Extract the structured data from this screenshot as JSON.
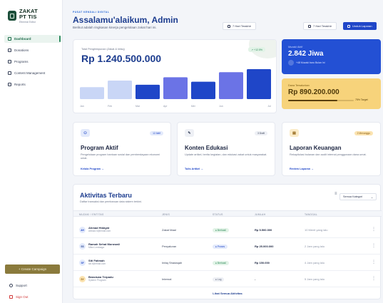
{
  "brand": {
    "title_line1": "ZAKAT",
    "title_line2": "PT TIS",
    "subtitle": "Ethereal Editor"
  },
  "sidebar": {
    "items": [
      {
        "label": "Dashboard",
        "icon": "grid-icon",
        "active": true
      },
      {
        "label": "Donations",
        "icon": "hand-heart-icon",
        "active": false
      },
      {
        "label": "Programs",
        "icon": "layers-icon",
        "active": false
      },
      {
        "label": "Content Management",
        "icon": "document-icon",
        "active": false
      },
      {
        "label": "Reports",
        "icon": "chart-report-icon",
        "active": false
      }
    ],
    "create_label": "+ Create Campaign",
    "support_label": "Support",
    "signout_label": "Sign Out"
  },
  "header": {
    "eyebrow": "PUSAT KENDALI DIGITAL",
    "greeting": "Assalamu'alaikum, Admin",
    "subtitle": "Berikut adalah ringkasan kinerja pengelolaan zakat hari ini.",
    "range_label": "7 Hari Terakhir",
    "range_label_2": "7 Hari Terakhir",
    "download_label": "Unduh Laporan"
  },
  "revenue": {
    "label": "Total Penghimpunan (Zakat & Infaq)",
    "value": "Rp 1.240.500.000",
    "badge": "↗ +12.5%"
  },
  "chart_data": {
    "type": "bar",
    "categories": [
      "Jan",
      "Feb",
      "Mar",
      "Apr",
      "Mei",
      "Jun",
      "Jul"
    ],
    "values": [
      0.4,
      0.62,
      0.48,
      0.73,
      0.58,
      0.9,
      1.0
    ],
    "colors": [
      "#c9d6f6",
      "#c9d6f6",
      "#1f46c8",
      "#6b73e6",
      "#1f46c8",
      "#6b73e6",
      "#1f46c8"
    ],
    "ticks": [
      "Jan",
      "Feb",
      "Mar",
      "Apr",
      "Mei",
      "Jun",
      "Jul"
    ],
    "tick_positions": [
      0,
      1,
      2,
      3,
      4,
      5,
      6
    ]
  },
  "donors": {
    "label": "Muzaki Aktif",
    "value": "2.842 Jiwa",
    "note": "+48 Muzaki baru Bulan Ini"
  },
  "funds": {
    "label": "Dana Tersalurkan",
    "value": "Rp 890.200.000",
    "target_label": "75% Target",
    "progress": 0.75
  },
  "features": [
    {
      "icon": "program-icon",
      "badge": "12 Aktif",
      "title": "Program Aktif",
      "desc": "Pengelolaan program bantuan sosial dan pemberdayaan ekonomi umat.",
      "link": "Kelola Program →"
    },
    {
      "icon": "edit-icon",
      "badge": "3 Draft",
      "title": "Konten Edukasi",
      "desc": "Update artikel, berita kegiatan, dan edukasi zakat untuk masyarakat.",
      "link": "Tulis Artikel →"
    },
    {
      "icon": "ledger-icon",
      "badge": "2 Menunggu",
      "title": "Laporan Keuangan",
      "desc": "Rekapitulasi bulanan dan audit internal penggunaan dana umat.",
      "link": "Review Laporan →"
    }
  ],
  "activity": {
    "title": "Aktivitas Terbaru",
    "subtitle": "Daftar transaksi dan pembaruan data sistem terkini.",
    "filter_label": "Semua Kategori",
    "columns": [
      "MUZAKI / ENTITAS",
      "JENIS",
      "STATUS",
      "JUMLAH",
      "TANGGAL"
    ],
    "rows": [
      {
        "initials": "AH",
        "name": "Ahmad Hidayat",
        "email": "ahmad.h@email.com",
        "type": "Zakat Maal",
        "status": "● Berhasil",
        "status_kind": "success",
        "amount": "Rp 5.500.000",
        "date": "10 Menit yang lalu"
      },
      {
        "initials": "SS",
        "name": "Ramah Sehat Morowali",
        "email": "Mitra Lembaga",
        "type": "Penyaluran",
        "status": "● Proses",
        "status_kind": "process",
        "amount": "Rp 25.000.000",
        "date": "2 Jam yang lalu"
      },
      {
        "initials": "SF",
        "name": "Siti Fatimah",
        "email": "siti.f@email.com",
        "type": "Infaq Shadaqah",
        "status": "● Berhasil",
        "status_kind": "success",
        "amount": "Rp 150.000",
        "date": "4 Jam yang lalu"
      },
      {
        "initials": "SY",
        "name": "Beasiswa Terpadu",
        "email": "System Program",
        "type": "Internal",
        "status": "● Log",
        "status_kind": "log",
        "amount": "-",
        "date": "5 Jam yang lalu"
      }
    ],
    "see_all": "Lihat Semua Aktivitas"
  }
}
